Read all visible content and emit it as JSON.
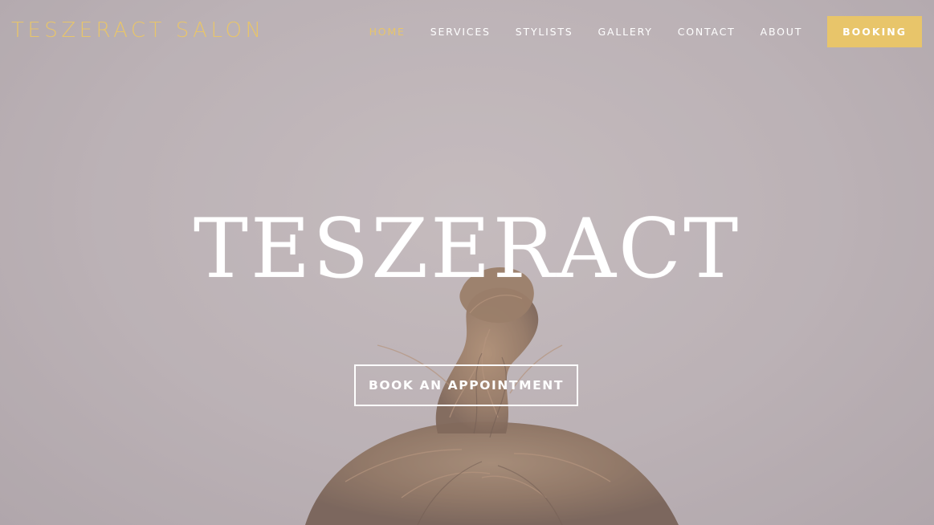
{
  "brand": {
    "logo": "TESZERACT SALON",
    "accent_color": "#e8c56a"
  },
  "nav": {
    "items": [
      {
        "label": "HOME",
        "active": true
      },
      {
        "label": "SERVICES",
        "active": false
      },
      {
        "label": "STYLISTS",
        "active": false
      },
      {
        "label": "GALLERY",
        "active": false
      },
      {
        "label": "CONTACT",
        "active": false
      },
      {
        "label": "ABOUT",
        "active": false
      }
    ],
    "booking_label": "BOOKING"
  },
  "hero": {
    "title": "TESZERACT",
    "cta_label": "BOOK AN APPOINTMENT",
    "background_image": "hair-bun-photo"
  }
}
